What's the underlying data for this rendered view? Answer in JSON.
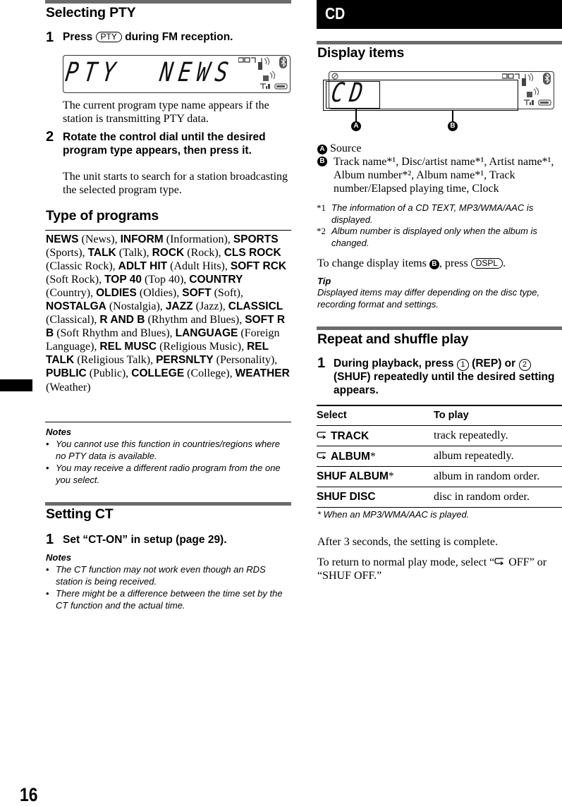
{
  "page": {
    "number": "16"
  },
  "left": {
    "selecting_pty": {
      "title": "Selecting PTY",
      "step1": {
        "num": "1",
        "before": "Press ",
        "key": "PTY",
        "after": " during FM reception."
      },
      "display": {
        "text_left": "PTY",
        "text_right": "NEWS",
        "indicator": "EQ7"
      },
      "step1_body": "The current program type name appears if the station is transmitting PTY data.",
      "step2": {
        "num": "2",
        "text": "Rotate the control dial until the desired program type appears, then press it."
      },
      "step2_body": "The unit starts to search for a station broadcasting the selected program type."
    },
    "type_of_programs": {
      "title": "Type of programs",
      "items": [
        {
          "code": "NEWS",
          "desc": "(News)"
        },
        {
          "code": "INFORM",
          "desc": "(Information)"
        },
        {
          "code": "SPORTS",
          "desc": "(Sports)"
        },
        {
          "code": "TALK",
          "desc": "(Talk)"
        },
        {
          "code": "ROCK",
          "desc": "(Rock)"
        },
        {
          "code": "CLS ROCK",
          "desc": "(Classic Rock)"
        },
        {
          "code": "ADLT HIT",
          "desc": "(Adult Hits)"
        },
        {
          "code": "SOFT RCK",
          "desc": "(Soft Rock)"
        },
        {
          "code": "TOP 40",
          "desc": "(Top 40)"
        },
        {
          "code": "COUNTRY",
          "desc": "(Country)"
        },
        {
          "code": "OLDIES",
          "desc": "(Oldies)"
        },
        {
          "code": "SOFT",
          "desc": "(Soft)"
        },
        {
          "code": "NOSTALGA",
          "desc": "(Nostalgia)"
        },
        {
          "code": "JAZZ",
          "desc": "(Jazz)"
        },
        {
          "code": "CLASSICL",
          "desc": "(Classical)"
        },
        {
          "code": "R AND B",
          "desc": "(Rhythm and Blues)"
        },
        {
          "code": "SOFT R B",
          "desc": "(Soft Rhythm and Blues)"
        },
        {
          "code": "LANGUAGE",
          "desc": "(Foreign Language)"
        },
        {
          "code": "REL MUSC",
          "desc": "(Religious Music)"
        },
        {
          "code": "REL TALK",
          "desc": "(Religious Talk)"
        },
        {
          "code": "PERSNLTY",
          "desc": "(Personality)"
        },
        {
          "code": "PUBLIC",
          "desc": "(Public)"
        },
        {
          "code": "COLLEGE",
          "desc": "(College)"
        },
        {
          "code": "WEATHER",
          "desc": "(Weather)"
        }
      ],
      "notes_title": "Notes",
      "notes": [
        "You cannot use this function in countries/regions where no PTY data is available.",
        "You may receive a different radio program from the one you select."
      ]
    },
    "setting_ct": {
      "title": "Setting CT",
      "step1": {
        "num": "1",
        "text": "Set “CT-ON” in setup (page 29)."
      },
      "notes_title": "Notes",
      "notes": [
        "The CT function may not work even though an RDS station is being received.",
        "There might be a difference between the time set by the CT function and the actual time."
      ]
    }
  },
  "right": {
    "section_label": "CD",
    "display_items": {
      "title": "Display items",
      "display": {
        "text": "CD",
        "indicator": "EQ7"
      },
      "callout_a": "A",
      "callout_b": "B",
      "item_a": "Source",
      "item_b": "Track name*¹, Disc/artist name*¹, Artist name*¹, Album number*², Album name*¹, Track number/Elapsed playing time, Clock",
      "footnotes": [
        {
          "mark": "*1",
          "text": "The information of a CD TEXT, MP3/WMA/AAC is displayed."
        },
        {
          "mark": "*2",
          "text": "Album number is displayed only when the album is changed."
        }
      ],
      "change": {
        "before": "To change display items ",
        "badge": "B",
        "middle": ", press ",
        "key": "DSPL",
        "after": "."
      },
      "tip_title": "Tip",
      "tip": "Displayed items may differ depending on the disc type, recording format and settings."
    },
    "repeat_shuffle": {
      "title": "Repeat and shuffle play",
      "step1": {
        "num": "1",
        "p1": "During playback, press ",
        "k1": "1",
        "p2": " (REP) or ",
        "k2": "2",
        "p3": " (SHUF) repeatedly until the desired setting appears."
      },
      "table": {
        "headers": [
          "Select",
          "To play"
        ],
        "rows": [
          {
            "icon": "repeat",
            "select": "TRACK",
            "star": "",
            "play": "track repeatedly."
          },
          {
            "icon": "repeat",
            "select": "ALBUM",
            "star": "*",
            "play": "album repeatedly."
          },
          {
            "icon": "",
            "select": "SHUF ALBUM",
            "star": "*",
            "play": "album in random order."
          },
          {
            "icon": "",
            "select": "SHUF DISC",
            "star": "",
            "play": "disc in random order."
          }
        ]
      },
      "footnote": "* When an MP3/WMA/AAC is played.",
      "after": "After 3 seconds, the setting is complete.",
      "return_before": "To return to normal play mode, select “",
      "return_mid": " OFF” or “SHUF OFF.”"
    }
  }
}
